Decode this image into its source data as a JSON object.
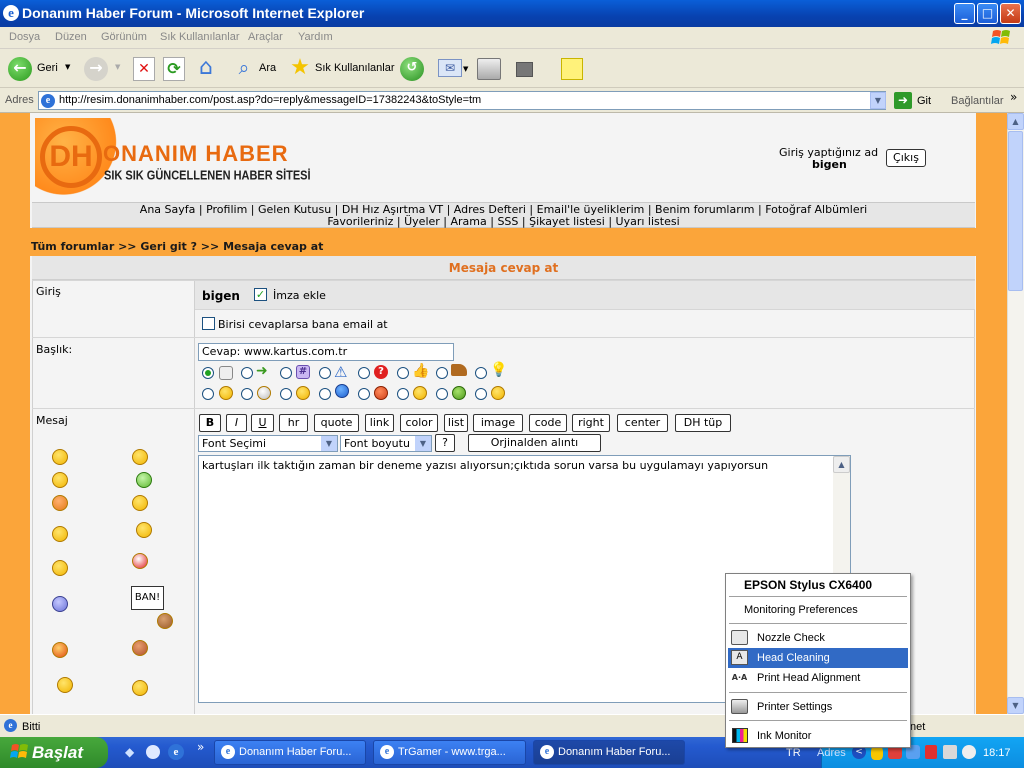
{
  "window": {
    "title": "Donanım Haber Forum - Microsoft Internet Explorer",
    "controls": [
      "_",
      "□",
      "✕"
    ]
  },
  "menu": [
    "Dosya",
    "Düzen",
    "Görünüm",
    "Sık Kullanılanlar",
    "Araçlar",
    "Yardım"
  ],
  "toolbar": {
    "back_label": "Geri",
    "search_label": "Ara",
    "favorites_label": "Sık Kullanılanlar"
  },
  "address": {
    "label": "Adres",
    "url": "http://resim.donanimhaber.com/post.asp?do=reply&messageID=17382243&toStyle=tm",
    "go_label": "Git",
    "links_label": "Bağlantılar"
  },
  "site": {
    "logo_text": "ONANIM HABER",
    "logo_tagline": "SIK SIK GÜNCELLENEN HABER SİTESİ",
    "login_label": "Giriş yaptığınız ad",
    "username": "bigen",
    "logout_label": "Çıkış",
    "nav_row1": "Ana Sayfa | Profilim | Gelen Kutusu | DH Hız Aşırtma VT | Adres Defteri | Email'le üyeliklerim | Benim forumlarım | Fotoğraf Albümleri",
    "nav_row2": "Favorileriniz | Üyeler | Arama | SSS | Şikayet listesi | Uyarı listesi",
    "breadcrumb": "Tüm forumlar >> Geri git ? >> Mesaja cevap at"
  },
  "form": {
    "header": "Mesaja cevap at",
    "login_label": "Giriş",
    "username": "bigen",
    "signature_label": "İmza ekle",
    "notify_label": "Birisi cevaplarsa bana email at",
    "subject_label": "Başlık:",
    "subject_value": "Cevap: www.kartus.com.tr",
    "message_label": "Mesaj",
    "format_buttons": [
      "B",
      "I",
      "U",
      "hr",
      "quote",
      "link",
      "color",
      "list",
      "image",
      "code",
      "right",
      "center",
      "DH tüp"
    ],
    "font_select": "Font Seçimi",
    "size_select": "Font boyutu",
    "help_button": "?",
    "quote_button": "Orjinalden alıntı",
    "message_text": "kartuşları ilk taktığın zaman bir deneme yazısı alıyorsun;çıktıda sorun varsa bu uygulamayı yapıyorsun",
    "ban_text": "BAN!"
  },
  "context_menu": {
    "title": "EPSON Stylus CX6400",
    "items": [
      "Monitoring Preferences",
      "Nozzle Check",
      "Head Cleaning",
      "Print Head Alignment",
      "Printer Settings",
      "Ink Monitor"
    ],
    "highlight_color": "#316AC5"
  },
  "status": {
    "text": "Bitti",
    "zone": "net"
  },
  "taskbar": {
    "start_label": "Başlat",
    "tasks": [
      "Donanım Haber Foru...",
      "TrGamer - www.trga...",
      "Donanım Haber Foru..."
    ],
    "lang": "TR",
    "addr_label": "Adres",
    "clock": "18:17"
  },
  "colors": {
    "titlebar": "#0A5FD8",
    "orange": "#FBA53A",
    "form_header_text": "#E07020",
    "taskbar": "#245ACF",
    "start": "#3C9A32"
  }
}
